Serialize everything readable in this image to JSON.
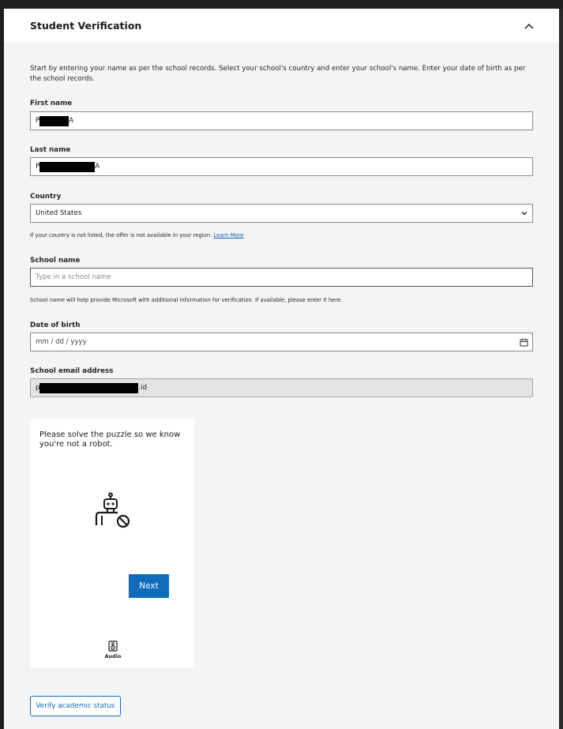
{
  "section": {
    "title": "Student Verification",
    "intro": "Start by entering your name as per the school records. Select your school's country and enter your school's name. Enter your date of birth as per the school records."
  },
  "form": {
    "first_name": {
      "label": "First name",
      "value_start": "P",
      "value_end": "A"
    },
    "last_name": {
      "label": "Last name",
      "value_start": "P",
      "value_end": "A"
    },
    "country": {
      "label": "Country",
      "selected": "United States",
      "hint": "If your country is not listed, the offer is not available in your region.",
      "hint_link": "Learn More"
    },
    "school_name": {
      "label": "School name",
      "placeholder": "Type in a school name",
      "hint": "School name will help provide Microsoft with additional information for verification. If available, please enter it here."
    },
    "dob": {
      "label": "Date of birth",
      "placeholder": "mm / dd / yyyy"
    },
    "school_email": {
      "label": "School email address",
      "value_start": "p",
      "value_end": ".id"
    }
  },
  "captcha": {
    "prompt": "Please solve the puzzle so we know you're not a robot.",
    "next_label": "Next",
    "audio_label": "Audio",
    "icons": [
      "robot-blocked-icon",
      "audio-speaker-icon"
    ]
  },
  "actions": {
    "verify_label": "Verify academic status"
  },
  "colors": {
    "accent": "#0f6cbd",
    "panel_bg": "#f3f4f6",
    "header_bg": "#ffffff",
    "redaction": "#000000"
  }
}
